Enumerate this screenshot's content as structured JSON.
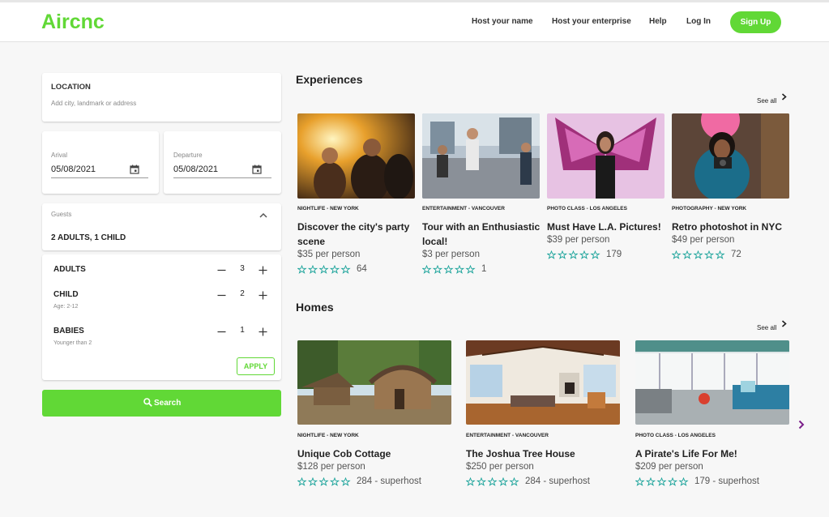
{
  "header": {
    "logo": "Aircnc",
    "nav": [
      "Host your name",
      "Host your enterprise",
      "Help",
      "Log In"
    ],
    "signup": "Sign Up"
  },
  "search_panel": {
    "location_label": "LOCATION",
    "location_placeholder": "Add city, landmark or address",
    "arrival_label": "Arival",
    "arrival_value": "05/08/2021",
    "departure_label": "Departure",
    "departure_value": "05/08/2021",
    "guests_label": "Guests",
    "guests_summary": "2 ADULTS, 1 CHILD",
    "rows": [
      {
        "label": "ADULTS",
        "hint": "",
        "count": "3"
      },
      {
        "label": "CHILD",
        "hint": "Age: 2-12",
        "count": "2"
      },
      {
        "label": "BABIES",
        "hint": "Younger than 2",
        "count": "1"
      }
    ],
    "apply": "APPLY",
    "search": "Search"
  },
  "experiences": {
    "title": "Experiences",
    "see_all": "See all",
    "items": [
      {
        "category": "NIGHTLIFE - NEW YORK",
        "title": "Discover the city's party scene",
        "price": "$35 per person",
        "reviews": "64"
      },
      {
        "category": "ENTERTAINMENT - VANCOUVER",
        "title": "Tour with an Enthusiastic local!",
        "price": "$3 per person",
        "reviews": "1"
      },
      {
        "category": "PHOTO CLASS - LOS ANGELES",
        "title": "Must Have L.A. Pictures!",
        "price": "$39 per person",
        "reviews": "179"
      },
      {
        "category": "PHOTOGRAPHY - NEW YORK",
        "title": "Retro photoshot in NYC",
        "price": "$49 per person",
        "reviews": "72"
      }
    ]
  },
  "homes": {
    "title": "Homes",
    "see_all": "See all",
    "items": [
      {
        "category": "NIGHTLIFE - NEW YORK",
        "title": "Unique Cob Cottage",
        "price": "$128 per person",
        "reviews": "284 - superhost"
      },
      {
        "category": "ENTERTAINMENT - VANCOUVER",
        "title": "The Joshua Tree House",
        "price": "$250 per person",
        "reviews": "284 - superhost"
      },
      {
        "category": "PHOTO CLASS - LOS ANGELES",
        "title": "A Pirate's Life For Me!",
        "price": "$209 per person",
        "reviews": "179 - superhost"
      }
    ]
  },
  "colors": {
    "brand": "#61d836",
    "star": "#1aa39a",
    "arrow": "#7b1f8a"
  }
}
